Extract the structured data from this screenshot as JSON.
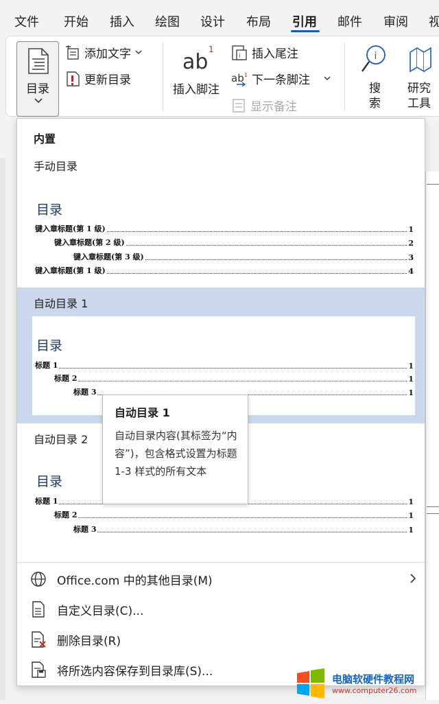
{
  "tabs": [
    "文件",
    "开始",
    "插入",
    "绘图",
    "设计",
    "布局",
    "引用",
    "邮件",
    "审阅",
    "视"
  ],
  "active_tab": "引用",
  "ribbon": {
    "toc_label": "目录",
    "add_text": "添加文字",
    "update_toc": "更新目录",
    "insert_footnote": "插入脚注",
    "insert_endnote": "插入尾注",
    "next_footnote": "下一条脚注",
    "show_notes": "显示备注",
    "search_label_1": "搜",
    "search_label_2": "索",
    "research_label_1": "研究",
    "research_label_2": "工具"
  },
  "dropdown": {
    "builtin_header": "内置",
    "manual": {
      "label": "手动目录",
      "title": "目录",
      "lines": [
        {
          "text": "键入章标题(第 1 级)",
          "page": "1"
        },
        {
          "text": "键入章标题(第 2 级)",
          "page": "2"
        },
        {
          "text": "键入章标题(第 3 级)",
          "page": "3"
        },
        {
          "text": "键入章标题(第 1 级)",
          "page": "4"
        }
      ]
    },
    "auto1": {
      "label": "自动目录 1",
      "title": "目录",
      "lines": [
        {
          "text": "标题 1",
          "page": "1"
        },
        {
          "text": "标题 2",
          "page": "1"
        },
        {
          "text": "标题 3",
          "page": "1"
        }
      ]
    },
    "auto2": {
      "label": "自动目录 2",
      "title": "目录",
      "lines": [
        {
          "text": "标题 1",
          "page": "1"
        },
        {
          "text": "标题 2",
          "page": "1"
        },
        {
          "text": "标题 3",
          "page": "1"
        }
      ]
    },
    "menu": {
      "more_office": "Office.com 中的其他目录(M)",
      "custom": "自定义目录(C)...",
      "remove": "删除目录(R)",
      "save": "将所选内容保存到目录库(S)..."
    }
  },
  "tooltip": {
    "title": "自动目录 1",
    "body": "自动目录内容(其标签为“内容”)，包含格式设置为标题 1-3 样式的所有文本"
  },
  "watermark": {
    "name": "电脑软硬件教程网",
    "url": "www.computer26.com"
  },
  "colors": {
    "accent": "#185abd",
    "highlight": "#cad7ec",
    "toc_title": "#1f3763"
  }
}
